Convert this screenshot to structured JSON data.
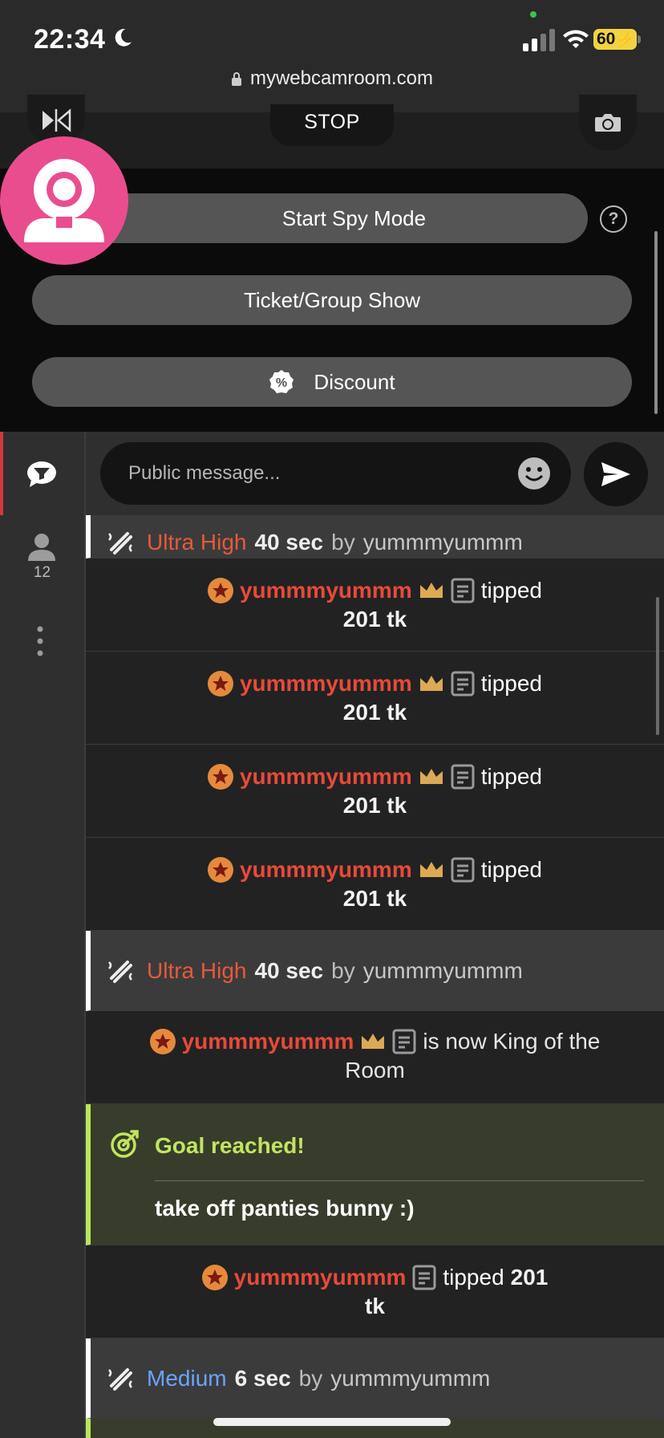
{
  "status_bar": {
    "time": "22:34",
    "battery": "60"
  },
  "browser": {
    "url": "mywebcamroom.com"
  },
  "controls": {
    "stop_label": "STOP"
  },
  "options": {
    "spy_mode_label": "Start Spy Mode",
    "help_label": "?",
    "ticket_label": "Ticket/Group Show",
    "discount_label": "Discount",
    "discount_badge": "%"
  },
  "sidebar": {
    "viewer_count": "12"
  },
  "chat_input": {
    "placeholder": "Public message..."
  },
  "chat": {
    "top_broadcast": {
      "level": "Ultra High",
      "duration": "40 sec",
      "by": "by",
      "user": "yummmyummm"
    },
    "tips": [
      {
        "user": "yummmyummm",
        "action": "tipped",
        "amount": "201 tk"
      },
      {
        "user": "yummmyummm",
        "action": "tipped",
        "amount": "201 tk"
      },
      {
        "user": "yummmyummm",
        "action": "tipped",
        "amount": "201 tk"
      },
      {
        "user": "yummmyummm",
        "action": "tipped",
        "amount": "201 tk"
      }
    ],
    "broadcast_2": {
      "level": "Ultra High",
      "duration": "40 sec",
      "by": "by",
      "user": "yummmyummm"
    },
    "king": {
      "user": "yummmyummm",
      "text_a": "is now King of the",
      "text_b": "Room"
    },
    "goal": {
      "title": "Goal reached!",
      "text": "take off panties bunny :)"
    },
    "tip_last": {
      "user": "yummmyummm",
      "action": "tipped",
      "amount_a": "201",
      "amount_b": "tk"
    },
    "broadcast_3": {
      "level": "Medium",
      "duration": "6 sec",
      "by": "by",
      "user": "yummmyummm"
    }
  },
  "colors": {
    "accent_red": "#e84a3a",
    "logo_pink": "#ea4d8e",
    "goal_green": "#c1e55e",
    "medium_blue": "#6aa4ff"
  },
  "icons": [
    "moon-icon",
    "signal-icon",
    "wifi-icon",
    "lock-icon",
    "mirror-icon",
    "camera-switch-icon",
    "webcam-logo-icon",
    "help-icon",
    "discount-icon",
    "chat-icon",
    "user-icon",
    "more-icon",
    "emoji-icon",
    "send-icon",
    "vibration-icon",
    "star-badge-icon",
    "crown-icon",
    "note-icon",
    "goal-icon"
  ]
}
